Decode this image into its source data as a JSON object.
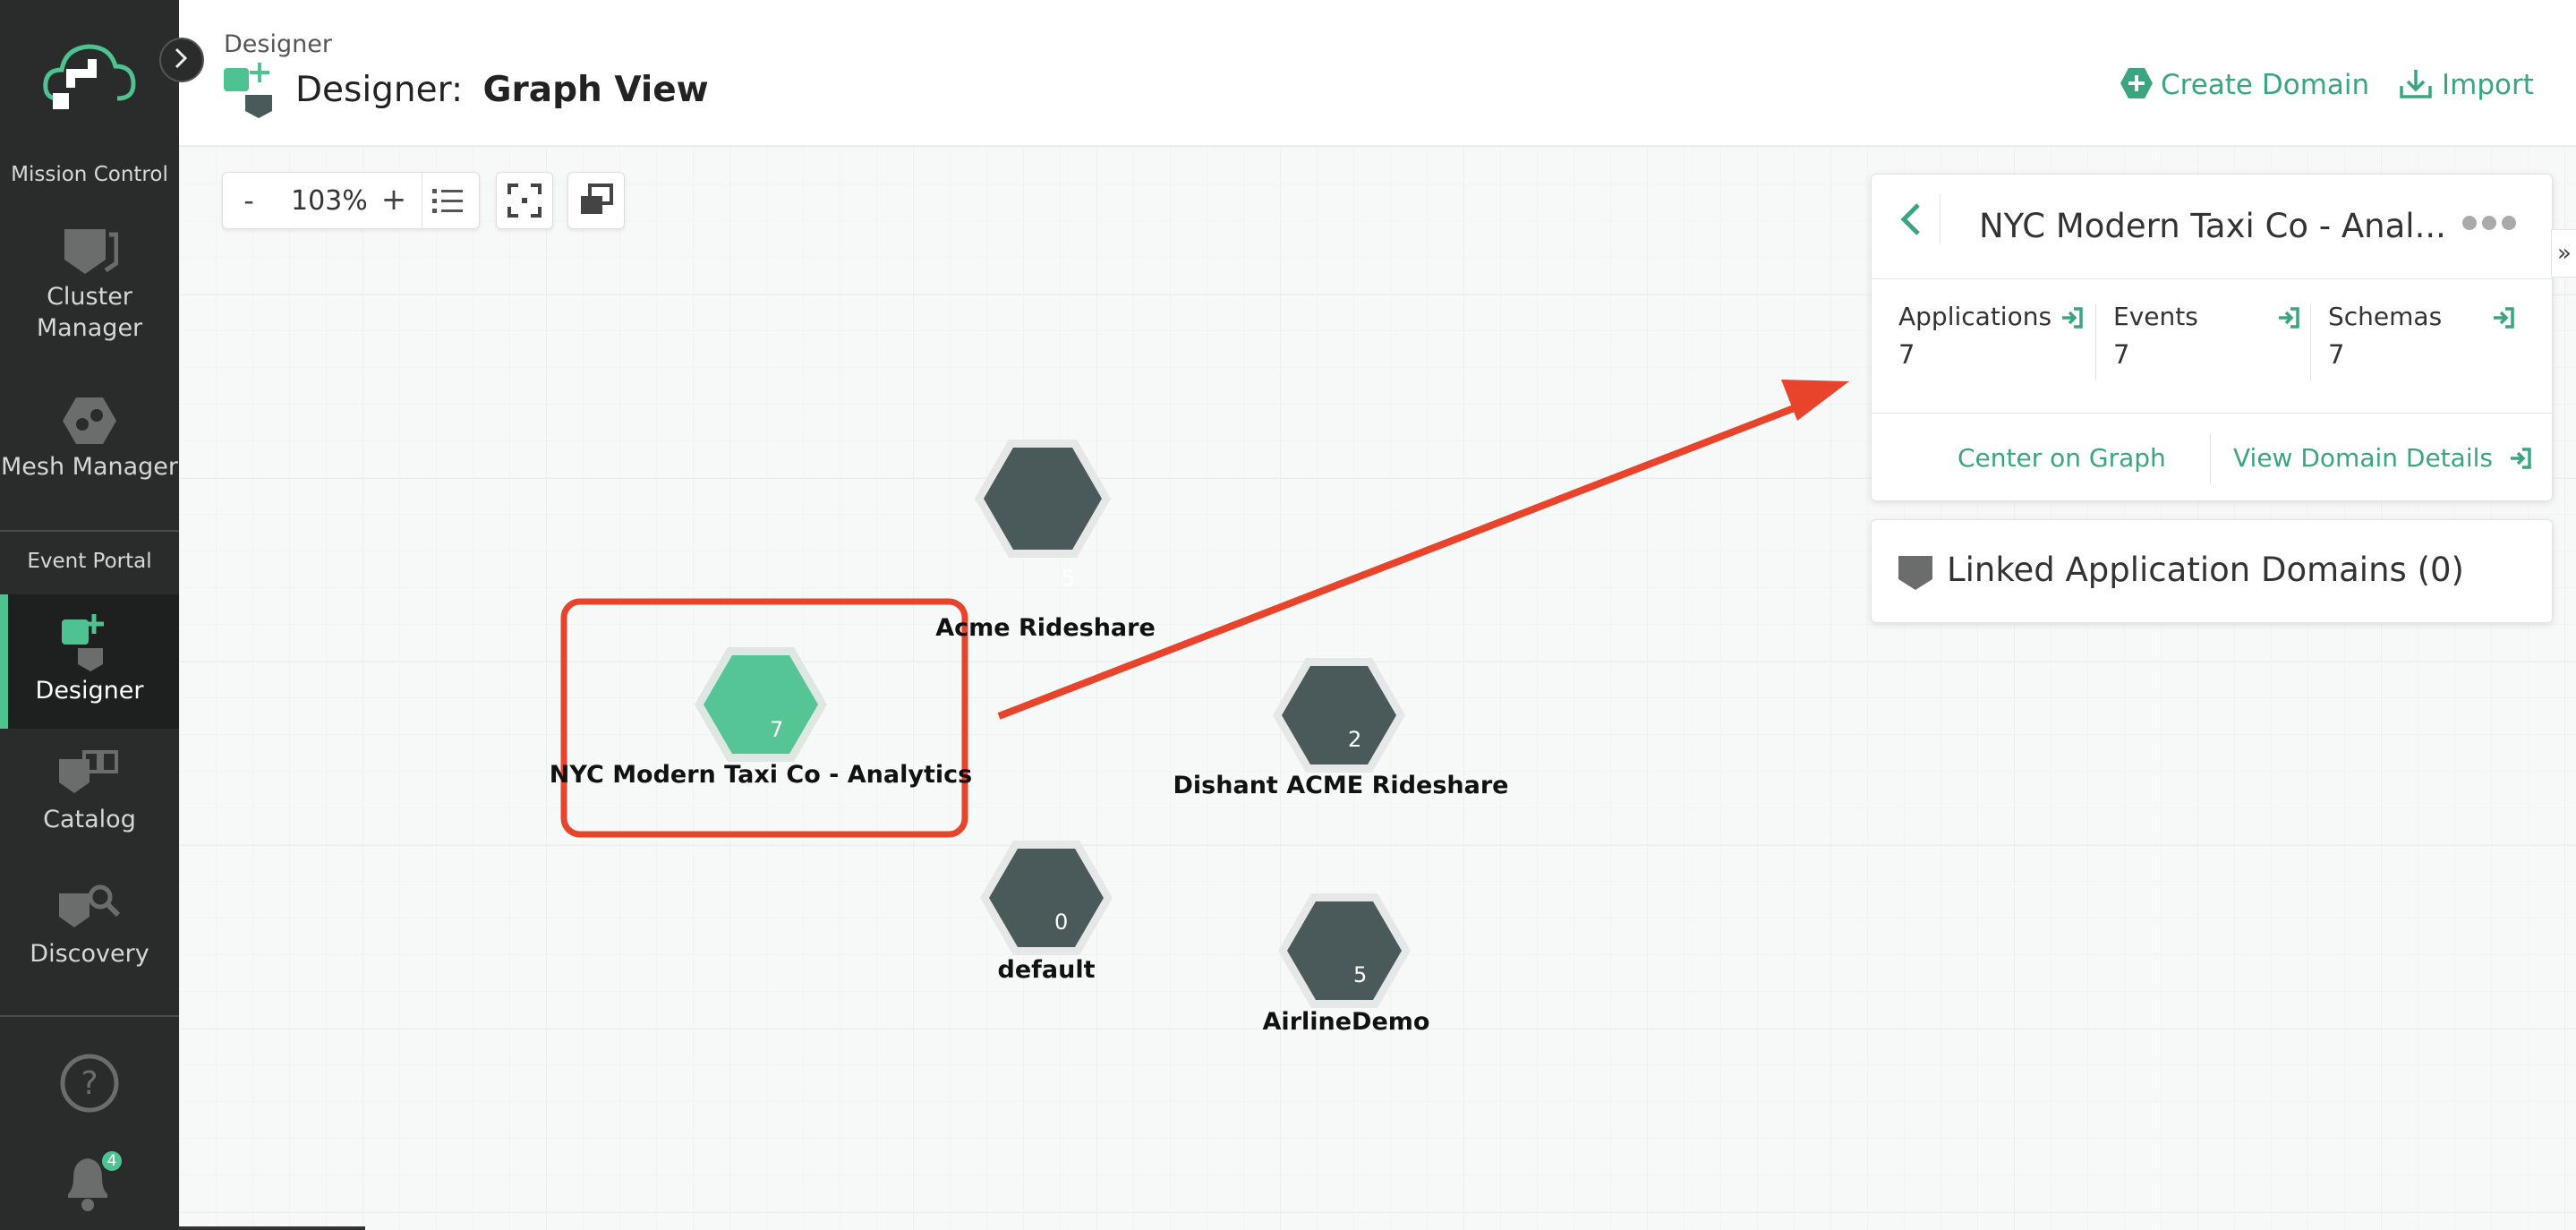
{
  "sidebar": {
    "section_mission": "Mission Control",
    "section_event": "Event Portal",
    "items": [
      {
        "label1": "Cluster",
        "label2": "Manager"
      },
      {
        "label": "Mesh Manager"
      },
      {
        "label": "Designer"
      },
      {
        "label": "Catalog"
      },
      {
        "label": "Discovery"
      }
    ],
    "notification_count": "4"
  },
  "header": {
    "breadcrumb": "Designer",
    "title_prefix": "Designer:",
    "title_main": "Graph View",
    "create_domain": "Create Domain",
    "import": "Import"
  },
  "toolbar": {
    "zoom_out": "-",
    "zoom_level": "103%",
    "zoom_in": "+"
  },
  "graph": {
    "nodes": [
      {
        "name": "Acme Rideshare",
        "count": "5"
      },
      {
        "name": "NYC Modern Taxi Co - Analytics",
        "count": "7",
        "selected": true
      },
      {
        "name": "Dishant ACME Rideshare",
        "count": "2"
      },
      {
        "name": "default",
        "count": "0"
      },
      {
        "name": "AirlineDemo",
        "count": "5"
      }
    ]
  },
  "panel": {
    "title": "NYC Modern Taxi Co - Anal...",
    "stats": [
      {
        "label": "Applications",
        "value": "7"
      },
      {
        "label": "Events",
        "value": "7"
      },
      {
        "label": "Schemas",
        "value": "7"
      }
    ],
    "center_on_graph": "Center on Graph",
    "view_details": "View Domain Details",
    "linked": "Linked Application Domains (0)"
  },
  "colors": {
    "accent": "#3aa57f",
    "node_dark": "#4a5a5a",
    "node_selected": "#56c595",
    "annotation": "#e8442c",
    "sidebar_bg": "#2a2b2b"
  }
}
